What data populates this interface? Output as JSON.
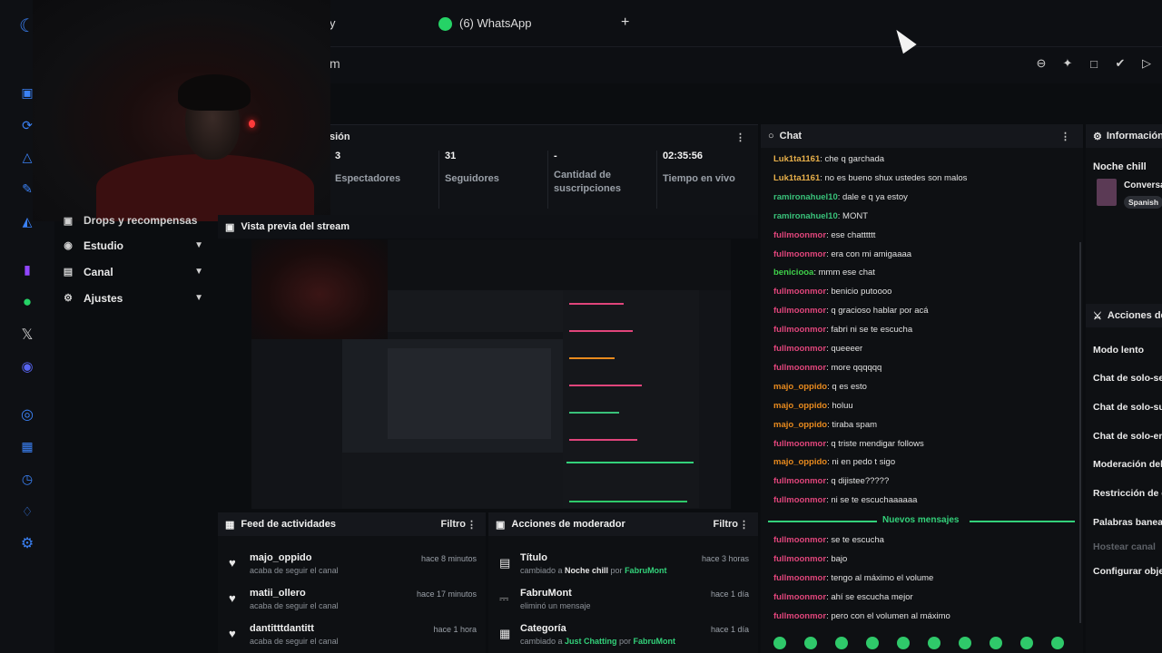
{
  "browser": {
    "tab_partial": "y",
    "tab_whatsapp": "(6) WhatsApp",
    "new_tab": "+",
    "url_partial": "m"
  },
  "menu": {
    "partial_item": "Drops y recompensas",
    "items": [
      {
        "label": "Estudio"
      },
      {
        "label": "Canal"
      },
      {
        "label": "Ajustes"
      }
    ]
  },
  "stats": {
    "title_partial": "sión",
    "cols": [
      {
        "value": "3",
        "label": "Espectadores"
      },
      {
        "value": "31",
        "label": "Seguidores"
      },
      {
        "value": "-",
        "label": "Cantidad de suscripciones"
      },
      {
        "value": "02:35:56",
        "label": "Tiempo en vivo"
      }
    ]
  },
  "preview": {
    "title": "Vista previa del stream"
  },
  "feed": {
    "title": "Feed de actividades",
    "filter": "Filtro",
    "items": [
      {
        "name": "majo_oppido",
        "sub": "acaba de seguir el canal",
        "time": "hace 8 minutos"
      },
      {
        "name": "matii_ollero",
        "sub": "acaba de seguir el canal",
        "time": "hace 17 minutos"
      },
      {
        "name": "dantitttdantitt",
        "sub": "acaba de seguir el canal",
        "time": "hace 1 hora"
      }
    ]
  },
  "mod": {
    "title": "Acciones de moderador",
    "filter": "Filtro",
    "items": [
      {
        "name": "Título",
        "pre": "cambiado a ",
        "val": "Noche chill",
        "mid": " por ",
        "user": "FabruMont",
        "time": "hace 3 horas"
      },
      {
        "name": "FabruMont",
        "pre": "eliminó un mensaje",
        "val": "",
        "mid": "",
        "user": "",
        "time": "hace 1 día"
      },
      {
        "name": "Categoría",
        "pre": "cambiado a ",
        "val": "Just Chatting",
        "mid": " por ",
        "user": "FabruMont",
        "time": "hace 1 día"
      }
    ]
  },
  "chat": {
    "title": "Chat",
    "new_messages": "Nuevos mensajes",
    "messages": [
      {
        "user": "Luk1ta1161",
        "text": ": che q garchada",
        "color": "#e8b04a"
      },
      {
        "user": "Luk1ta1161",
        "text": ": no es bueno shux ustedes son malos",
        "color": "#e8b04a"
      },
      {
        "user": "ramironahuel10",
        "text": ": dale e q ya estoy",
        "color": "#39c27a"
      },
      {
        "user": "ramironahuel10",
        "text": ": MONT",
        "color": "#39c27a"
      },
      {
        "user": "fullmoonmor",
        "text": ": ese chatttttt",
        "color": "#e0457b"
      },
      {
        "user": "fullmoonmor",
        "text": ": era con mi amigaaaa",
        "color": "#e0457b"
      },
      {
        "user": "beniciooa",
        "text": ": mmm ese chat",
        "color": "#3fd14a"
      },
      {
        "user": "fullmoonmor",
        "text": ": benicio putoooo",
        "color": "#e0457b"
      },
      {
        "user": "fullmoonmor",
        "text": ": q gracioso hablar por acá",
        "color": "#e0457b"
      },
      {
        "user": "fullmoonmor",
        "text": ": fabri ni se te escucha",
        "color": "#e0457b"
      },
      {
        "user": "fullmoonmor",
        "text": ": queeeer",
        "color": "#e0457b"
      },
      {
        "user": "fullmoonmor",
        "text": ": more qqqqqq",
        "color": "#e0457b"
      },
      {
        "user": "majo_oppido",
        "text": ": q es esto",
        "color": "#e88a1e"
      },
      {
        "user": "majo_oppido",
        "text": ": holuu",
        "color": "#e88a1e"
      },
      {
        "user": "majo_oppido",
        "text": ": tiraba spam",
        "color": "#e88a1e"
      },
      {
        "user": "fullmoonmor",
        "text": ": q triste mendigar follows",
        "color": "#e0457b"
      },
      {
        "user": "majo_oppido",
        "text": ": ni en pedo t sigo",
        "color": "#e88a1e"
      },
      {
        "user": "fullmoonmor",
        "text": ": q dijistee?????",
        "color": "#e0457b"
      },
      {
        "user": "fullmoonmor",
        "text": ": ni se te escuchaaaaaa",
        "color": "#e0457b"
      },
      {
        "user": "fullmoonmor",
        "text": ": se te escucha",
        "color": "#e0457b"
      },
      {
        "user": "fullmoonmor",
        "text": ": bajo",
        "color": "#e0457b"
      },
      {
        "user": "fullmoonmor",
        "text": ": tengo al máximo el volume",
        "color": "#e0457b"
      },
      {
        "user": "fullmoonmor",
        "text": ": ahí se escucha mejor",
        "color": "#e0457b"
      },
      {
        "user": "fullmoonmor",
        "text": ": pero con el volumen al máximo",
        "color": "#e0457b"
      }
    ]
  },
  "info": {
    "title": "Información",
    "stream_title": "Noche chill",
    "category_partial": "Conversa",
    "tag": "Spanish",
    "actions_title": "Acciones de",
    "actions": [
      "Modo lento",
      "Chat de solo-se",
      "Chat de solo-su",
      "Chat de solo-en",
      "Moderación del",
      "Restricción de e",
      "Palabras banea",
      "Hostear canal",
      "Configurar obje"
    ]
  },
  "colors": {
    "accent": "#3b82f6",
    "green": "#33d17a"
  },
  "icons": [
    "logo-icon",
    "whatsapp-icon",
    "twitch-icon",
    "x-icon",
    "discord-icon",
    "zoom-out-icon",
    "pin-icon",
    "crop-icon",
    "shield-icon",
    "send-icon",
    "heart-icon",
    "trash-icon"
  ]
}
